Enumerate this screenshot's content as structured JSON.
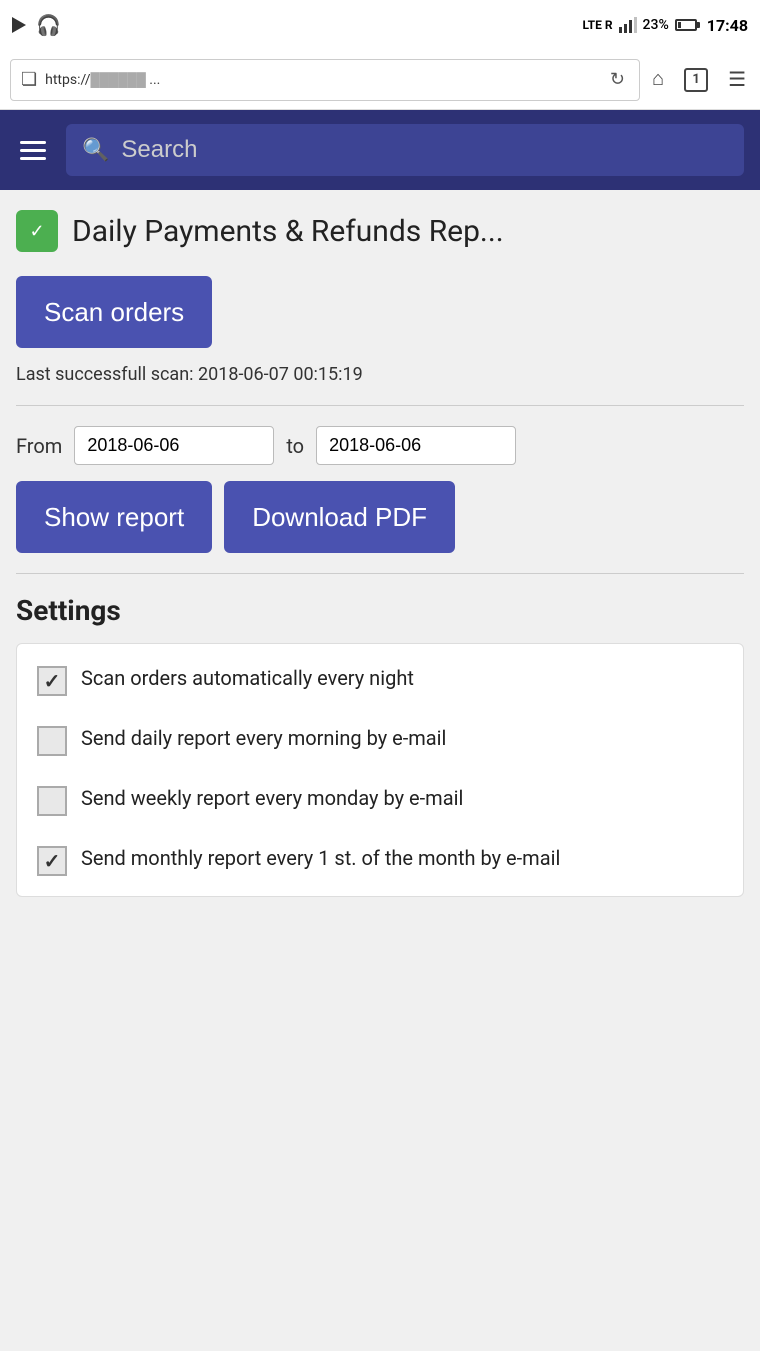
{
  "statusBar": {
    "lte": "LTE R",
    "signal": "▲",
    "battery": "23%",
    "time": "17:48"
  },
  "browserBar": {
    "url": "https://",
    "urlMasked": "...",
    "tabCount": "1"
  },
  "header": {
    "searchPlaceholder": "Search"
  },
  "page": {
    "title": "Daily Payments & Refunds Rep...",
    "scanButton": "Scan orders",
    "lastScan": "Last successfull scan: 2018-06-07 00:15:19",
    "fromLabel": "From",
    "toLabel": "to",
    "fromDate": "2018-06-06",
    "toDate": "2018-06-06",
    "showReportButton": "Show report",
    "downloadPdfButton": "Download PDF",
    "settingsTitle": "Settings",
    "settings": [
      {
        "label": "Scan orders automatically every night",
        "checked": true
      },
      {
        "label": "Send daily report every morning by e-mail",
        "checked": false
      },
      {
        "label": "Send weekly report every monday by e-mail",
        "checked": false
      },
      {
        "label": "Send monthly report every 1 st. of the month by e-mail",
        "checked": true
      }
    ]
  }
}
